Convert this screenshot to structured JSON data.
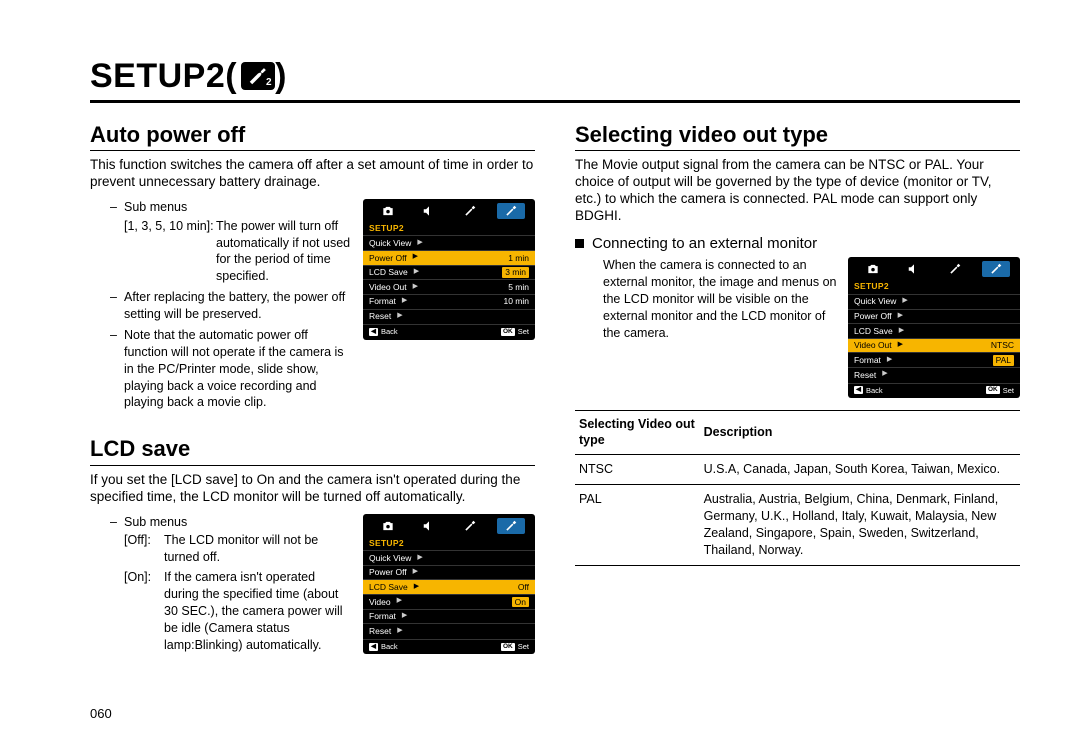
{
  "page": {
    "title_prefix": "SETUP2(",
    "title_suffix": ")",
    "icon_sub": "2",
    "number": "060"
  },
  "left": {
    "s1": {
      "heading": "Auto power off",
      "intro": "This function switches the camera off after a set amount of time in order to prevent unnecessary battery drainage.",
      "sub_label": "Sub menus",
      "opt_key": "[1, 3, 5, 10 min]:",
      "opt_val": "The power will turn off automatically if not used for the period of time specified.",
      "note2": "After replacing the battery, the power off setting will be preserved.",
      "note3": "Note that the automatic power off function will not operate if the camera is in the PC/Printer mode, slide show, playing back a voice recording and playing back a movie clip."
    },
    "s2": {
      "heading": "LCD save",
      "intro": "If you set the [LCD save] to On and the camera isn't operated during the specified time, the LCD monitor will be turned off automatically.",
      "sub_label": "Sub menus",
      "off_key": "[Off]:",
      "off_val": "The LCD monitor will not be turned off.",
      "on_key": "[On]:",
      "on_val": "If the camera isn't operated during the specified time (about 30 SEC.), the camera power will be idle (Camera status lamp:Blinking) automatically."
    }
  },
  "right": {
    "heading": "Selecting video out type",
    "intro": "The Movie output signal from the camera can be NTSC or PAL. Your choice of output will be governed by the type of device (monitor or TV, etc.) to which the camera is connected. PAL mode can support only BDGHI.",
    "bullet": "Connecting to an external monitor",
    "bullet_body": "When the camera is connected to an external monitor, the image and menus on the LCD monitor will be visible on the external monitor and the LCD monitor of the camera.",
    "table": {
      "h1": "Selecting Video out type",
      "h2": "Description",
      "rows": [
        {
          "k": "NTSC",
          "v": "U.S.A, Canada, Japan, South Korea, Taiwan, Mexico."
        },
        {
          "k": "PAL",
          "v": "Australia, Austria, Belgium, China, Denmark, Finland, Germany, U.K., Holland, Italy, Kuwait, Malaysia, New Zealand, Singapore, Spain, Sweden, Switzerland, Thailand, Norway."
        }
      ]
    }
  },
  "lcd": {
    "header": "SETUP2",
    "rows_poweroff": {
      "r1": "Quick View",
      "r2": "Power Off",
      "r3": "LCD Save",
      "r4": "Video Out",
      "r5": "Format",
      "r6": "Reset",
      "v2": "1 min",
      "v3": "3 min",
      "v4": "5 min",
      "v5": "10 min"
    },
    "rows_lcdsave": {
      "r1": "Quick View",
      "r2": "Power Off",
      "r3": "LCD Save",
      "r4": "Video",
      "r5": "Format",
      "r6": "Reset",
      "v3": "Off",
      "v4": "On"
    },
    "rows_video": {
      "r1": "Quick View",
      "r2": "Power Off",
      "r3": "LCD Save",
      "r4": "Video Out",
      "r5": "Format",
      "r6": "Reset",
      "v4": "NTSC",
      "v5": "PAL"
    },
    "footer_back": "Back",
    "footer_set": "Set",
    "key_back": "◀",
    "key_ok": "OK"
  }
}
